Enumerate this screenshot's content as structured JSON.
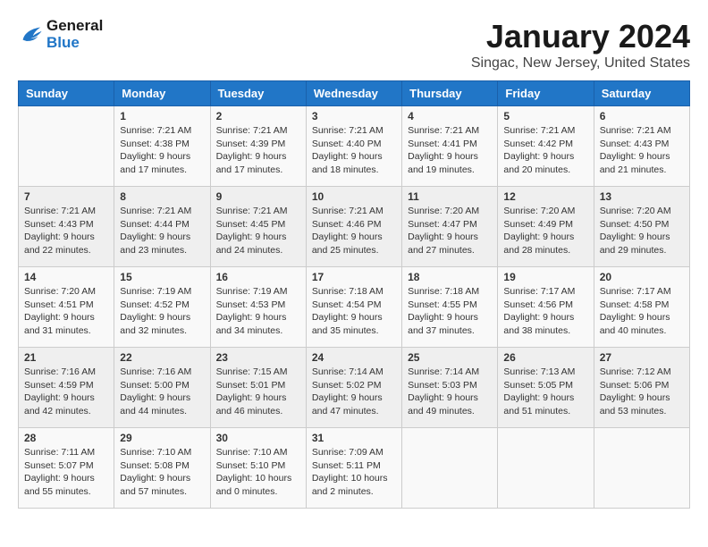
{
  "header": {
    "logo_line1": "General",
    "logo_line2": "Blue",
    "month": "January 2024",
    "location": "Singac, New Jersey, United States"
  },
  "weekdays": [
    "Sunday",
    "Monday",
    "Tuesday",
    "Wednesday",
    "Thursday",
    "Friday",
    "Saturday"
  ],
  "weeks": [
    [
      {
        "day": "",
        "sunrise": "",
        "sunset": "",
        "daylight": ""
      },
      {
        "day": "1",
        "sunrise": "Sunrise: 7:21 AM",
        "sunset": "Sunset: 4:38 PM",
        "daylight": "Daylight: 9 hours and 17 minutes."
      },
      {
        "day": "2",
        "sunrise": "Sunrise: 7:21 AM",
        "sunset": "Sunset: 4:39 PM",
        "daylight": "Daylight: 9 hours and 17 minutes."
      },
      {
        "day": "3",
        "sunrise": "Sunrise: 7:21 AM",
        "sunset": "Sunset: 4:40 PM",
        "daylight": "Daylight: 9 hours and 18 minutes."
      },
      {
        "day": "4",
        "sunrise": "Sunrise: 7:21 AM",
        "sunset": "Sunset: 4:41 PM",
        "daylight": "Daylight: 9 hours and 19 minutes."
      },
      {
        "day": "5",
        "sunrise": "Sunrise: 7:21 AM",
        "sunset": "Sunset: 4:42 PM",
        "daylight": "Daylight: 9 hours and 20 minutes."
      },
      {
        "day": "6",
        "sunrise": "Sunrise: 7:21 AM",
        "sunset": "Sunset: 4:43 PM",
        "daylight": "Daylight: 9 hours and 21 minutes."
      }
    ],
    [
      {
        "day": "7",
        "sunrise": "Sunrise: 7:21 AM",
        "sunset": "Sunset: 4:43 PM",
        "daylight": "Daylight: 9 hours and 22 minutes."
      },
      {
        "day": "8",
        "sunrise": "Sunrise: 7:21 AM",
        "sunset": "Sunset: 4:44 PM",
        "daylight": "Daylight: 9 hours and 23 minutes."
      },
      {
        "day": "9",
        "sunrise": "Sunrise: 7:21 AM",
        "sunset": "Sunset: 4:45 PM",
        "daylight": "Daylight: 9 hours and 24 minutes."
      },
      {
        "day": "10",
        "sunrise": "Sunrise: 7:21 AM",
        "sunset": "Sunset: 4:46 PM",
        "daylight": "Daylight: 9 hours and 25 minutes."
      },
      {
        "day": "11",
        "sunrise": "Sunrise: 7:20 AM",
        "sunset": "Sunset: 4:47 PM",
        "daylight": "Daylight: 9 hours and 27 minutes."
      },
      {
        "day": "12",
        "sunrise": "Sunrise: 7:20 AM",
        "sunset": "Sunset: 4:49 PM",
        "daylight": "Daylight: 9 hours and 28 minutes."
      },
      {
        "day": "13",
        "sunrise": "Sunrise: 7:20 AM",
        "sunset": "Sunset: 4:50 PM",
        "daylight": "Daylight: 9 hours and 29 minutes."
      }
    ],
    [
      {
        "day": "14",
        "sunrise": "Sunrise: 7:20 AM",
        "sunset": "Sunset: 4:51 PM",
        "daylight": "Daylight: 9 hours and 31 minutes."
      },
      {
        "day": "15",
        "sunrise": "Sunrise: 7:19 AM",
        "sunset": "Sunset: 4:52 PM",
        "daylight": "Daylight: 9 hours and 32 minutes."
      },
      {
        "day": "16",
        "sunrise": "Sunrise: 7:19 AM",
        "sunset": "Sunset: 4:53 PM",
        "daylight": "Daylight: 9 hours and 34 minutes."
      },
      {
        "day": "17",
        "sunrise": "Sunrise: 7:18 AM",
        "sunset": "Sunset: 4:54 PM",
        "daylight": "Daylight: 9 hours and 35 minutes."
      },
      {
        "day": "18",
        "sunrise": "Sunrise: 7:18 AM",
        "sunset": "Sunset: 4:55 PM",
        "daylight": "Daylight: 9 hours and 37 minutes."
      },
      {
        "day": "19",
        "sunrise": "Sunrise: 7:17 AM",
        "sunset": "Sunset: 4:56 PM",
        "daylight": "Daylight: 9 hours and 38 minutes."
      },
      {
        "day": "20",
        "sunrise": "Sunrise: 7:17 AM",
        "sunset": "Sunset: 4:58 PM",
        "daylight": "Daylight: 9 hours and 40 minutes."
      }
    ],
    [
      {
        "day": "21",
        "sunrise": "Sunrise: 7:16 AM",
        "sunset": "Sunset: 4:59 PM",
        "daylight": "Daylight: 9 hours and 42 minutes."
      },
      {
        "day": "22",
        "sunrise": "Sunrise: 7:16 AM",
        "sunset": "Sunset: 5:00 PM",
        "daylight": "Daylight: 9 hours and 44 minutes."
      },
      {
        "day": "23",
        "sunrise": "Sunrise: 7:15 AM",
        "sunset": "Sunset: 5:01 PM",
        "daylight": "Daylight: 9 hours and 46 minutes."
      },
      {
        "day": "24",
        "sunrise": "Sunrise: 7:14 AM",
        "sunset": "Sunset: 5:02 PM",
        "daylight": "Daylight: 9 hours and 47 minutes."
      },
      {
        "day": "25",
        "sunrise": "Sunrise: 7:14 AM",
        "sunset": "Sunset: 5:03 PM",
        "daylight": "Daylight: 9 hours and 49 minutes."
      },
      {
        "day": "26",
        "sunrise": "Sunrise: 7:13 AM",
        "sunset": "Sunset: 5:05 PM",
        "daylight": "Daylight: 9 hours and 51 minutes."
      },
      {
        "day": "27",
        "sunrise": "Sunrise: 7:12 AM",
        "sunset": "Sunset: 5:06 PM",
        "daylight": "Daylight: 9 hours and 53 minutes."
      }
    ],
    [
      {
        "day": "28",
        "sunrise": "Sunrise: 7:11 AM",
        "sunset": "Sunset: 5:07 PM",
        "daylight": "Daylight: 9 hours and 55 minutes."
      },
      {
        "day": "29",
        "sunrise": "Sunrise: 7:10 AM",
        "sunset": "Sunset: 5:08 PM",
        "daylight": "Daylight: 9 hours and 57 minutes."
      },
      {
        "day": "30",
        "sunrise": "Sunrise: 7:10 AM",
        "sunset": "Sunset: 5:10 PM",
        "daylight": "Daylight: 10 hours and 0 minutes."
      },
      {
        "day": "31",
        "sunrise": "Sunrise: 7:09 AM",
        "sunset": "Sunset: 5:11 PM",
        "daylight": "Daylight: 10 hours and 2 minutes."
      },
      {
        "day": "",
        "sunrise": "",
        "sunset": "",
        "daylight": ""
      },
      {
        "day": "",
        "sunrise": "",
        "sunset": "",
        "daylight": ""
      },
      {
        "day": "",
        "sunrise": "",
        "sunset": "",
        "daylight": ""
      }
    ]
  ]
}
